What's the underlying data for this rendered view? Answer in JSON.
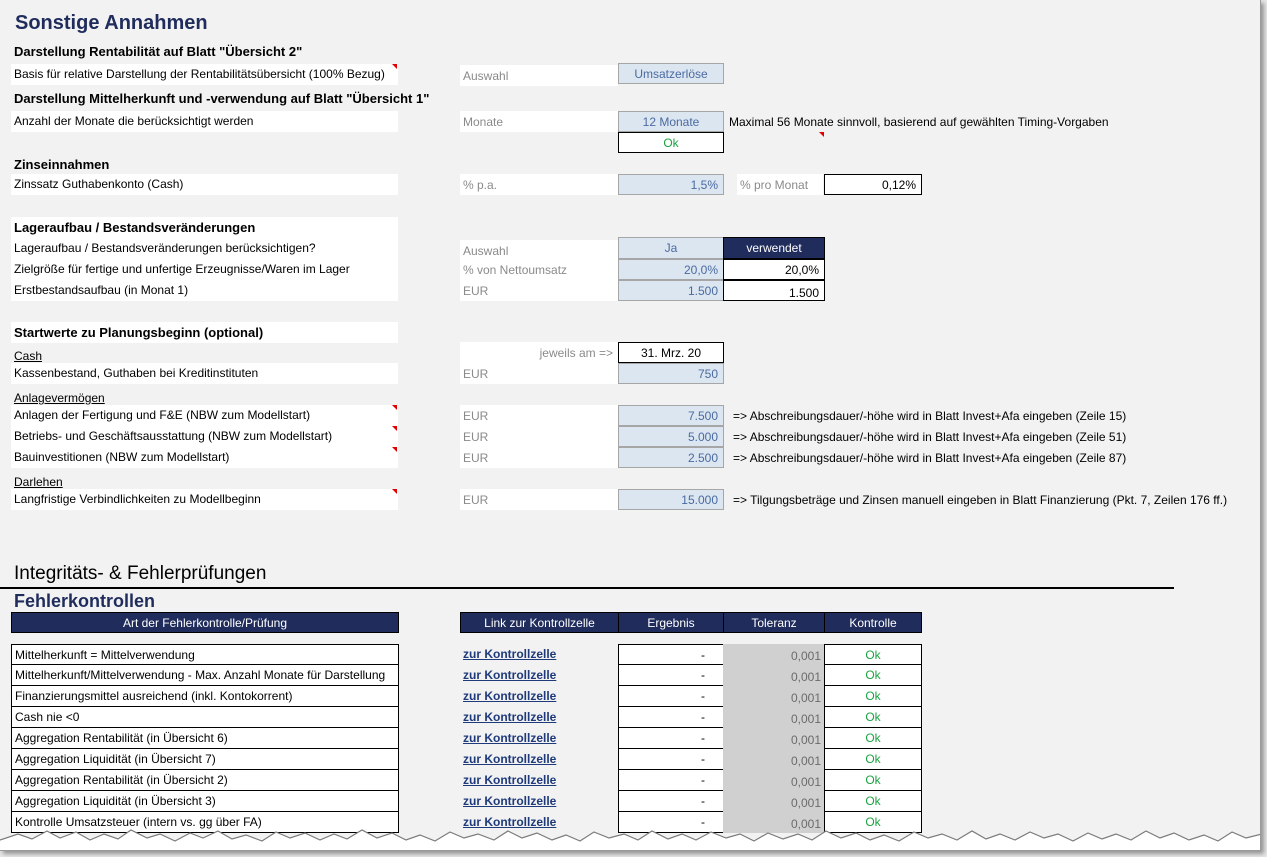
{
  "title": "Sonstige Annahmen",
  "rent": {
    "heading": "Darstellung Rentabilität auf Blatt \"Übersicht 2\"",
    "basis_label": "Basis für relative Darstellung der Rentabilitätsübersicht (100% Bezug)",
    "basis_unit": "Auswahl",
    "basis_value": "Umsatzerlöse"
  },
  "mittel": {
    "heading": "Darstellung Mittelherkunft und -verwendung auf Blatt \"Übersicht 1\"",
    "months_label": "Anzahl der Monate die berücksichtigt werden",
    "months_unit": "Monate",
    "months_value": "12 Monate",
    "months_note": "Maximal 56 Monate sinnvoll, basierend auf gewählten Timing-Vorgaben",
    "months_status": "Ok"
  },
  "zins": {
    "heading": "Zinseinnahmen",
    "rate_label": "Zinssatz Guthabenkonto (Cash)",
    "rate_unit": "% p.a.",
    "rate_value": "1,5%",
    "monthly_label": "% pro Monat",
    "monthly_value": "0,12%"
  },
  "lager": {
    "heading": "Lageraufbau / Bestandsveränderungen",
    "consider_label": "Lageraufbau / Bestandsveränderungen berücksichtigen?",
    "consider_unit": "Auswahl",
    "consider_value": "Ja",
    "consider_status": "verwendet",
    "target_label": "Zielgröße für fertige und unfertige Erzeugnisse/Waren im Lager",
    "target_unit": "% von Nettoumsatz",
    "target_value": "20,0%",
    "target_used": "20,0%",
    "initial_label": "Erstbestandsaufbau (in Monat 1)",
    "initial_unit": "EUR",
    "initial_value": "1.500",
    "initial_used": "1.500"
  },
  "start": {
    "heading": "Startwerte zu Planungsbeginn (optional)",
    "cash_heading": "Cash",
    "date_label": "jeweils am =>",
    "date_value": "31. Mrz. 20",
    "cash_label": "Kassenbestand, Guthaben bei Kreditinstituten",
    "cash_unit": "EUR",
    "cash_value": "750",
    "anlage_heading": "Anlagevermögen",
    "anlage_rows": [
      {
        "label": "Anlagen der Fertigung und F&E (NBW zum Modellstart)",
        "unit": "EUR",
        "value": "7.500",
        "note": "=> Abschreibungsdauer/-höhe wird in Blatt Invest+Afa eingeben (Zeile 15)"
      },
      {
        "label": "Betriebs- und Geschäftsausstattung (NBW zum Modellstart)",
        "unit": "EUR",
        "value": "5.000",
        "note": "=> Abschreibungsdauer/-höhe wird in Blatt Invest+Afa eingeben (Zeile 51)"
      },
      {
        "label": "Bauinvestitionen (NBW zum Modellstart)",
        "unit": "EUR",
        "value": "2.500",
        "note": "=> Abschreibungsdauer/-höhe wird in Blatt Invest+Afa eingeben (Zeile 87)"
      }
    ],
    "darlehen_heading": "Darlehen",
    "loan_label": "Langfristige Verbindlichkeiten zu Modellbeginn",
    "loan_unit": "EUR",
    "loan_value": "15.000",
    "loan_note": "=> Tilgungsbeträge und Zinsen manuell eingeben in Blatt Finanzierung (Pkt. 7, Zeilen 176 ff.)"
  },
  "integrity": {
    "heading": "Integritäts- & Fehlerprüfungen",
    "subheading": "Fehlerkontrollen",
    "columns": [
      "Art der Fehlerkontrolle/Prüfung",
      "Link zur Kontrollzelle",
      "Ergebnis",
      "Toleranz",
      "Kontrolle"
    ],
    "rows": [
      {
        "check": "Mittelherkunft = Mittelverwendung",
        "link": "zur Kontrollzelle",
        "result": "-",
        "tolerance": "0,001",
        "status": "Ok"
      },
      {
        "check": "Mittelherkunft/Mittelverwendung - Max. Anzahl Monate für Darstellung",
        "link": "zur Kontrollzelle",
        "result": "-",
        "tolerance": "0,001",
        "status": "Ok"
      },
      {
        "check": "Finanzierungsmittel ausreichend (inkl. Kontokorrent)",
        "link": "zur Kontrollzelle",
        "result": "-",
        "tolerance": "0,001",
        "status": "Ok"
      },
      {
        "check": "Cash nie <0",
        "link": "zur Kontrollzelle",
        "result": "-",
        "tolerance": "0,001",
        "status": "Ok"
      },
      {
        "check": "Aggregation Rentabilität (in Übersicht 6)",
        "link": "zur Kontrollzelle",
        "result": "-",
        "tolerance": "0,001",
        "status": "Ok"
      },
      {
        "check": "Aggregation Liquidität (in Übersicht 7)",
        "link": "zur Kontrollzelle",
        "result": "-",
        "tolerance": "0,001",
        "status": "Ok"
      },
      {
        "check": "Aggregation Rentabilität (in Übersicht 2)",
        "link": "zur Kontrollzelle",
        "result": "-",
        "tolerance": "0,001",
        "status": "Ok"
      },
      {
        "check": "Aggregation Liquidität (in Übersicht 3)",
        "link": "zur Kontrollzelle",
        "result": "-",
        "tolerance": "0,001",
        "status": "Ok"
      },
      {
        "check": "Kontrolle Umsatzsteuer (intern vs. gg über FA)",
        "link": "zur Kontrollzelle",
        "result": "-",
        "tolerance": "0,001",
        "status": "Ok"
      }
    ]
  },
  "colors": {
    "header_navy": "#1f2c5c",
    "input_blue": "#dce6f1",
    "ok_green": "#1aa340",
    "note_red": "#e00000"
  }
}
